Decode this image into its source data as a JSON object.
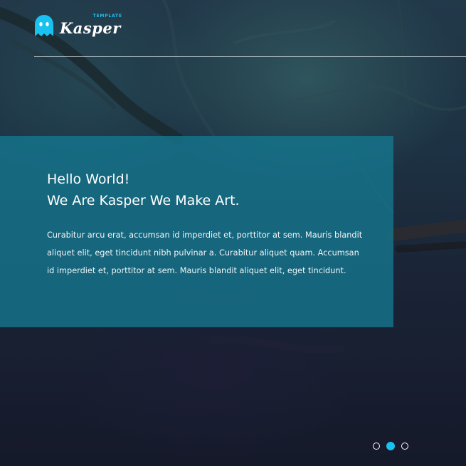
{
  "brand": {
    "name": "Kasper",
    "tag": "TEMPLATE",
    "accent_color": "#19c1f0",
    "icon": "ghost-icon"
  },
  "hero": {
    "title_line1": "Hello World!",
    "title_line2": "We Are Kasper We Make Art.",
    "text": "Curabitur arcu erat, accumsan id imperdiet et, porttitor at sem. Mauris blandit aliquet elit, eget tincidunt nibh pulvinar a. Curabitur aliquet quam. Accumsan id imperdiet et, porttitor at sem. Mauris blandit aliquet elit, eget tincidunt.",
    "card_color": "#157991"
  },
  "slider": {
    "count": 3,
    "active_index": 1
  }
}
